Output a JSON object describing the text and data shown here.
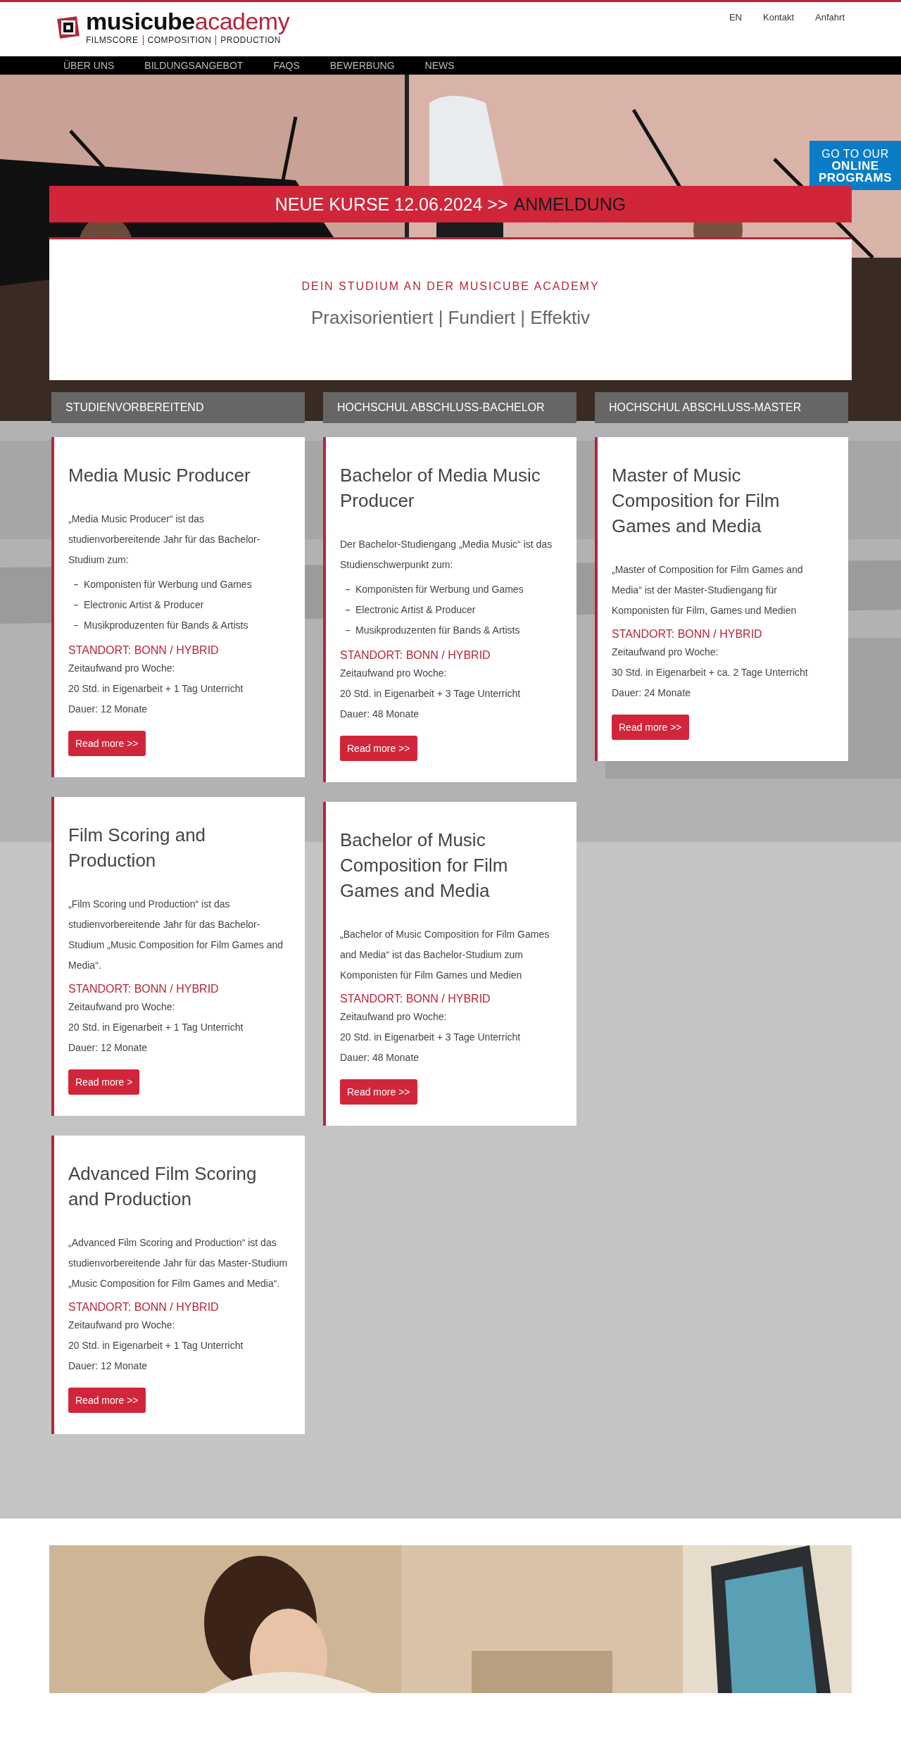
{
  "header": {
    "logo": {
      "name_bold": "musicube",
      "name_light": "academy",
      "tagline": [
        "FILMSCORE",
        "COMPOSITION",
        "PRODUCTION"
      ]
    },
    "top_links": [
      "EN",
      "Kontakt",
      "Anfahrt"
    ]
  },
  "nav": [
    {
      "label": "ÜBER UNS"
    },
    {
      "label": "BILDUNGSANGEBOT"
    },
    {
      "label": "FAQS"
    },
    {
      "label": "BEWERBUNG"
    },
    {
      "label": "NEWS"
    }
  ],
  "online_badge": {
    "line_1": "GO TO OUR",
    "line_2": "ONLINE",
    "line_3": "PROGRAMS"
  },
  "banner": {
    "text": "NEUE KURSE 12.06.2024 >>",
    "link": "ANMELDUNG"
  },
  "intro": {
    "kicker": "DEIN STUDIUM AN DER MUSICUBE ACADEMY",
    "headline": "Praxisorientiert | Fundiert | Effektiv"
  },
  "columns": [
    {
      "heading": "STUDIENVORBEREITEND",
      "courses": [
        {
          "title": "Media Music Producer",
          "description": "„Media Music Producer“ ist das studienvorbereitende Jahr für das Bachelor-Studium zum:",
          "list": [
            "Komponisten für Werbung und Games",
            "Electronic Artist & Producer",
            "Musikproduzenten für Bands & Artists"
          ],
          "location": "STANDORT: BONN / HYBRID",
          "time_label": "Zeitaufwand pro Woche:",
          "time": "20 Std. in Eigenarbeit + 1 Tag Unterricht",
          "duration": "Dauer: 12 Monate",
          "button": "Read more >>"
        },
        {
          "title": "Film Scoring and Production",
          "description": "„Film Scoring und Production“ ist das studienvorbereitende Jahr für das Bachelor-Studium „Music Composition for Film Games and Media“.",
          "location": "STANDORT: BONN / HYBRID",
          "time_label": "Zeitaufwand pro Woche:",
          "time": "20 Std. in Eigenarbeit + 1 Tag Unterricht",
          "duration": "Dauer: 12 Monate",
          "button": "Read more >"
        },
        {
          "title": "Advanced Film Scoring and Production",
          "description": "„Advanced Film Scoring and Production“ ist das studienvorbereitende Jahr für das Master-Studium „Music Composition for Film Games and Media“.",
          "location": "STANDORT: BONN / HYBRID",
          "time_label": "Zeitaufwand pro Woche:",
          "time": "20 Std. in Eigenarbeit + 1 Tag Unterricht",
          "duration": "Dauer: 12 Monate",
          "button": "Read more >>"
        }
      ]
    },
    {
      "heading": "HOCHSCHUL ABSCHLUSS-BACHELOR",
      "courses": [
        {
          "title": "Bachelor of Media Music Producer",
          "description": "Der Bachelor-Studiengang „Media Music“ ist das Studienschwerpunkt zum:",
          "list": [
            "Komponisten für Werbung und Games",
            "Electronic Artist & Producer",
            "Musikproduzenten für Bands & Artists"
          ],
          "location": "STANDORT: BONN / HYBRID",
          "time_label": "Zeitaufwand pro Woche:",
          "time": "20 Std. in Eigenarbeit + 3 Tage Unterricht",
          "duration": "Dauer: 48 Monate",
          "button": "Read more >>"
        },
        {
          "title": "Bachelor of Music Composition for Film Games and Media",
          "description": "„Bachelor of Music Composition for Film Games and Media“ ist das Bachelor-Studium zum Komponisten für Film Games und Medien",
          "location": "STANDORT: BONN / HYBRID",
          "time_label": "Zeitaufwand pro Woche:",
          "time": "20 Std. in Eigenarbeit + 3 Tage Unterricht",
          "duration": "Dauer: 48 Monate",
          "button": "Read more >>"
        }
      ]
    },
    {
      "heading": "HOCHSCHUL ABSCHLUSS-MASTER",
      "courses": [
        {
          "title": "Master of Music Composition for Film Games and Media",
          "description": "„Master of Composition for Film Games and Media“ ist der Master-Studiengang für Komponisten für Film, Games und Medien",
          "location": "STANDORT: BONN / HYBRID",
          "time_label": "Zeitaufwand pro Woche:",
          "time": "30 Std. in Eigenarbeit + ca. 2 Tage Unterricht",
          "duration": "Dauer: 24 Monate",
          "button": "Read more >>"
        }
      ]
    }
  ]
}
